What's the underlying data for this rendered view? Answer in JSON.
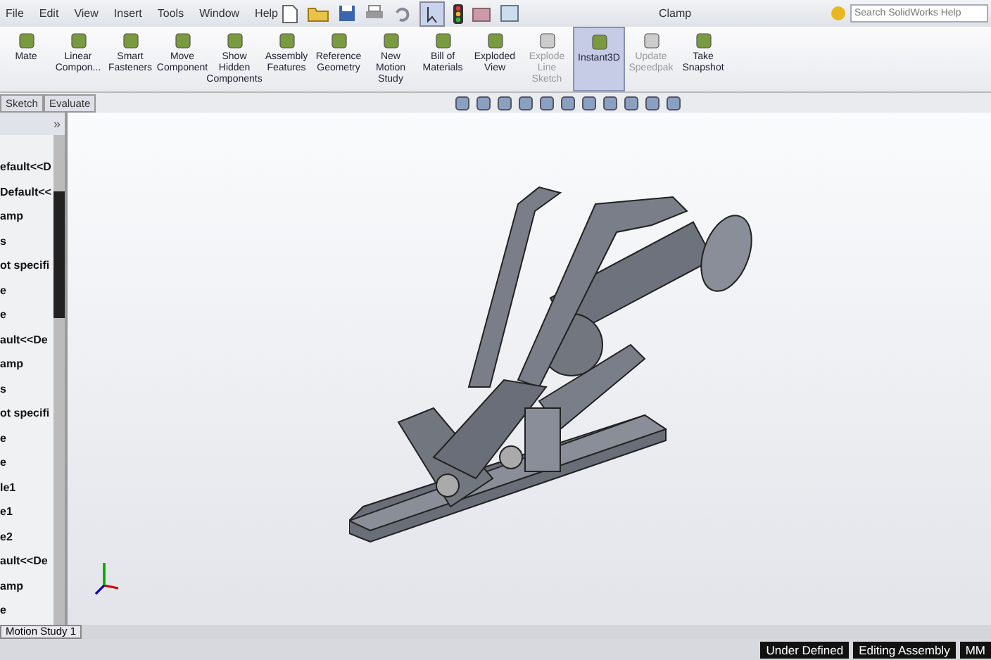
{
  "menu": [
    "File",
    "Edit",
    "View",
    "Insert",
    "Tools",
    "Window",
    "Help"
  ],
  "window": {
    "title": "Clamp"
  },
  "search": {
    "placeholder": "Search SolidWorks Help"
  },
  "ribbon": [
    {
      "label": "Mate",
      "disabled": false,
      "selected": false
    },
    {
      "label": "Linear Compon...",
      "disabled": false,
      "selected": false
    },
    {
      "label": "Smart Fasteners",
      "disabled": false,
      "selected": false
    },
    {
      "label": "Move Component",
      "disabled": false,
      "selected": false
    },
    {
      "label": "Show Hidden Components",
      "disabled": false,
      "selected": false
    },
    {
      "label": "Assembly Features",
      "disabled": false,
      "selected": false
    },
    {
      "label": "Reference Geometry",
      "disabled": false,
      "selected": false
    },
    {
      "label": "New Motion Study",
      "disabled": false,
      "selected": false
    },
    {
      "label": "Bill of Materials",
      "disabled": false,
      "selected": false
    },
    {
      "label": "Exploded View",
      "disabled": false,
      "selected": false
    },
    {
      "label": "Explode Line Sketch",
      "disabled": true,
      "selected": false
    },
    {
      "label": "Instant3D",
      "disabled": false,
      "selected": true
    },
    {
      "label": "Update Speedpak",
      "disabled": true,
      "selected": false
    },
    {
      "label": "Take Snapshot",
      "disabled": false,
      "selected": false
    }
  ],
  "tabs": [
    {
      "label": "Sketch",
      "selected": false
    },
    {
      "label": "Evaluate",
      "selected": false
    }
  ],
  "tree": {
    "collapse": "»",
    "items": [
      "efault<<D",
      "Default<<",
      "amp",
      "s",
      "ot specifi",
      "e",
      "e",
      "ault<<De",
      "amp",
      "s",
      "ot specifi",
      "e",
      "e",
      "le1",
      "e1",
      "e2",
      "ault<<De",
      "amp",
      "e"
    ]
  },
  "bottom_tab": "Motion Study 1",
  "status_bar": [
    "Under Defined",
    "Editing Assembly",
    "MM"
  ]
}
